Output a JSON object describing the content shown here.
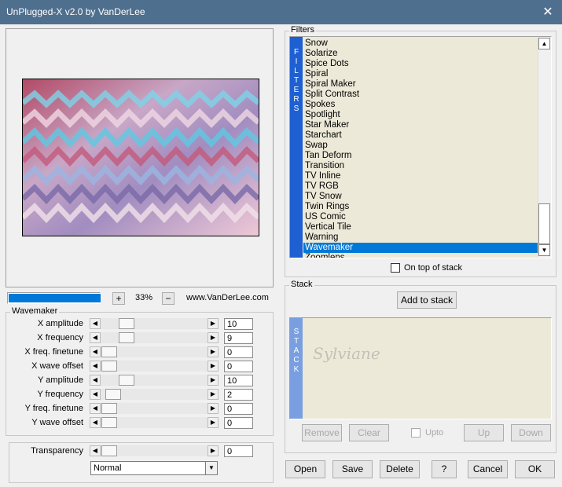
{
  "window": {
    "title": "UnPlugged-X v2.0 by VanDerLee",
    "close_glyph": "✕"
  },
  "preview": {
    "zoom": "33%",
    "zoom_in": "+",
    "zoom_out": "−",
    "website": "www.VanDerLee.com",
    "progress": 1.0
  },
  "filters": {
    "group_label": "Filters",
    "vertical_label": "FILTERS",
    "items": [
      "Snow",
      "Solarize",
      "Spice Dots",
      "Spiral",
      "Spiral Maker",
      "Split Contrast",
      "Spokes",
      "Spotlight",
      "Star Maker",
      "Starchart",
      "Swap",
      "Tan Deform",
      "Transition",
      "TV Inline",
      "TV RGB",
      "TV Snow",
      "Twin Rings",
      "US Comic",
      "Vertical Tile",
      "Warning",
      "Wavemaker",
      "Zoomlens"
    ],
    "selected": "Wavemaker",
    "on_top_label": "On top of stack",
    "on_top_checked": false
  },
  "wavemaker": {
    "group_label": "Wavemaker",
    "params": [
      {
        "label": "X amplitude",
        "value": "10"
      },
      {
        "label": "X frequency",
        "value": "9"
      },
      {
        "label": "X freq. finetune",
        "value": "0"
      },
      {
        "label": "X wave offset",
        "value": "0"
      },
      {
        "label": "Y amplitude",
        "value": "10"
      },
      {
        "label": "Y frequency",
        "value": "2"
      },
      {
        "label": "Y freq. finetune",
        "value": "0"
      },
      {
        "label": "Y wave offset",
        "value": "0"
      }
    ],
    "transparency": {
      "label": "Transparency",
      "value": "0"
    },
    "blend_mode": "Normal"
  },
  "stack": {
    "group_label": "Stack",
    "add_label": "Add to stack",
    "vertical_label": "STACK",
    "remove_label": "Remove",
    "clear_label": "Clear",
    "upto_label": "Upto",
    "up_label": "Up",
    "down_label": "Down"
  },
  "footer": {
    "open": "Open",
    "save": "Save",
    "delete": "Delete",
    "help": "?",
    "cancel": "Cancel",
    "ok": "OK"
  },
  "watermark_text": "Sylviane",
  "colors": {
    "titlebar": "#4f6f8f",
    "accent": "#0078d7",
    "filter_bar": "#1e5fd2",
    "stack_bar": "#7a9fe0",
    "list_bg": "#ece9d8"
  }
}
